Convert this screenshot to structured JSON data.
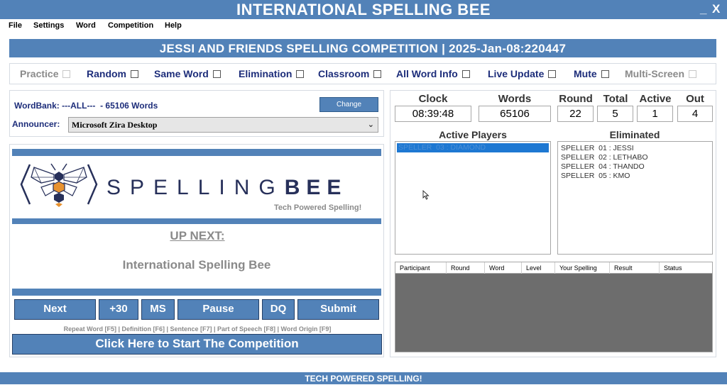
{
  "window": {
    "title": "INTERNATIONAL SPELLING BEE",
    "minimize": "_",
    "close": "X"
  },
  "menu": {
    "items": [
      "File",
      "Settings",
      "Word",
      "Competition",
      "Help"
    ]
  },
  "banner": "JESSI AND FRIENDS SPELLING COMPETITION | 2025-Jan-08:220447",
  "modes": [
    {
      "label": "Practice",
      "enabled": false
    },
    {
      "label": "Random",
      "enabled": true
    },
    {
      "label": "Same Word",
      "enabled": true
    },
    {
      "label": "Elimination",
      "enabled": true
    },
    {
      "label": "Classroom",
      "enabled": true
    },
    {
      "label": "All Word Info",
      "enabled": true
    },
    {
      "label": "Live Update",
      "enabled": true
    },
    {
      "label": "Mute",
      "enabled": true
    },
    {
      "label": "Multi-Screen",
      "enabled": false
    }
  ],
  "wordbank": {
    "label": "WordBank:",
    "value": "---ALL---  - 65106 Words",
    "change_label": "Change"
  },
  "announcer": {
    "label": "Announcer:",
    "value": "Microsoft Zira Desktop"
  },
  "logo": {
    "letters": "SPELLING",
    "bold_word": "BEE",
    "tagline": "Tech Powered Spelling!"
  },
  "upnext": {
    "label": "UP NEXT:",
    "word": "International Spelling Bee"
  },
  "controls": {
    "next": "Next",
    "plus30": "+30",
    "ms": "MS",
    "pause": "Pause",
    "dq": "DQ",
    "submit": "Submit"
  },
  "hints": "Repeat Word [F5] | Definition [F6] | Sentence [F7] | Part of Speech [F8] | Word Origin [F9]",
  "start_label": "Click Here to Start The Competition",
  "stats": {
    "clock": {
      "label": "Clock",
      "value": "08:39:48"
    },
    "words": {
      "label": "Words",
      "value": "65106"
    },
    "round": {
      "label": "Round",
      "value": "22"
    },
    "total": {
      "label": "Total",
      "value": "5"
    },
    "active": {
      "label": "Active",
      "value": "1"
    },
    "out": {
      "label": "Out",
      "value": "4"
    }
  },
  "active_players": {
    "label": "Active Players",
    "items": [
      "SPELLER  03 : DIAMOND"
    ]
  },
  "eliminated": {
    "label": "Eliminated",
    "items": [
      "SPELLER  01 : JESSI",
      "SPELLER  02 : LETHABO",
      "SPELLER  04 : THANDO",
      "SPELLER  05 : KMO"
    ]
  },
  "results_table": {
    "columns": [
      "Participant",
      "Round",
      "Word",
      "Level",
      "Your Spelling",
      "Result",
      "Status"
    ]
  },
  "footer": "TECH POWERED SPELLING!",
  "colors": {
    "accent": "#5282b8",
    "nav_text": "#1d2d7a",
    "muted": "#8a8a8a",
    "selection": "#1e78d2",
    "bee_orange": "#e8922f",
    "bee_navy": "#27305a"
  }
}
